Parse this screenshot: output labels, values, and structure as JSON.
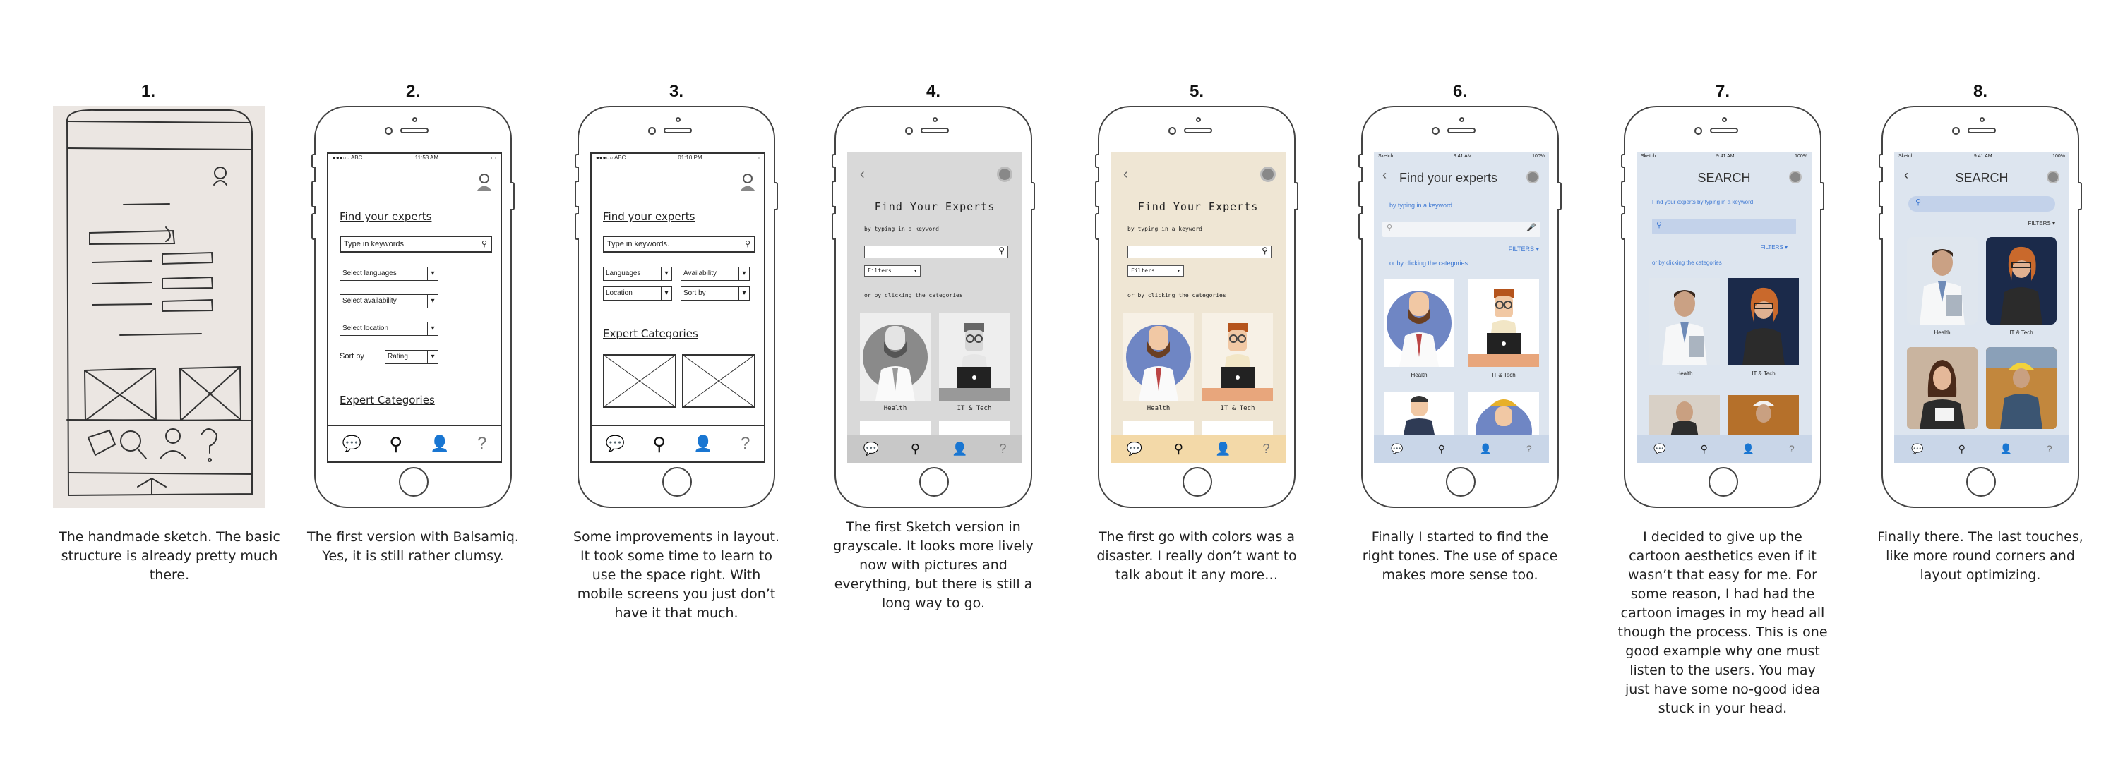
{
  "steps": [
    {
      "num": "1.",
      "caption": "The handmade sketch. The basic structure is already pretty much there."
    },
    {
      "num": "2.",
      "caption": "The first version with Balsamiq. Yes, it is still rather clumsy."
    },
    {
      "num": "3.",
      "caption": "Some improvements in layout. It took some time to learn to use the space right. With mobile screens you just don’t have it that much."
    },
    {
      "num": "4.",
      "caption": "The first Sketch version in grayscale. It looks more lively now with pictures and everything, but there is still a long way to go."
    },
    {
      "num": "5.",
      "caption": "The first go with colors was a disaster. I really don’t want to talk about it any more…"
    },
    {
      "num": "6.",
      "caption": "Finally I started to find the right tones. The use of space makes more sense too."
    },
    {
      "num": "7.",
      "caption": "I decided to give up the cartoon aesthetics even if it wasn’t that easy for me. For some reason, I had had the cartoon images in my head all though the process. This is one good example why one must listen to the users. You may just have some no-good idea stuck in your head."
    },
    {
      "num": "8.",
      "caption": "Finally there. The last touches, like more round corners and layout optimizing."
    }
  ],
  "balsamiq": {
    "status_carrier": "●●●○○ ABC",
    "status_time_v2": "11:53 AM",
    "status_time_v3": "01:10 PM",
    "title": "Find your experts",
    "search_placeholder": "Type in keywords.",
    "select_languages": "Select languages",
    "select_availability": "Select availability",
    "select_location": "Select location",
    "sort_label": "Sort by",
    "sort_value": "Rating",
    "categories_title": "Expert Categories",
    "languages": "Languages",
    "availability": "Availability",
    "location": "Location",
    "sort_by": "Sort by"
  },
  "sketch": {
    "title": "Find Your Experts",
    "subtitle": "by typing in a keyword",
    "filters": "Filters",
    "categories_hint": "or by clicking the categories",
    "cat_health": "Health",
    "cat_it": "IT & Tech"
  },
  "v6": {
    "status_left": "Sketch",
    "status_time": "9:41 AM",
    "status_right": "100%",
    "title": "Find your experts",
    "subtitle": "by typing in a keyword",
    "filters": "FILTERS",
    "categories_hint": "or by clicking the categories",
    "cat_health": "Health",
    "cat_it": "IT & Tech"
  },
  "v7": {
    "title": "SEARCH",
    "subtitle": "Find your experts by typing in a keyword",
    "filters": "FILTERS",
    "categories_hint": "or by clicking the categories",
    "cat_health": "Health",
    "cat_it": "IT & Tech"
  },
  "v8": {
    "title": "SEARCH",
    "filters": "FILTERS",
    "cat_health": "Health",
    "cat_it": "IT & Tech"
  },
  "colors": {
    "gray_screen": "#d9d9d9",
    "beige_screen": "#efe6d4",
    "beige_tab": "#f3d9a8",
    "blue_screen": "#dde5ef",
    "blue_tab": "#c9d6e8",
    "accent_blue": "#3f79d3"
  }
}
